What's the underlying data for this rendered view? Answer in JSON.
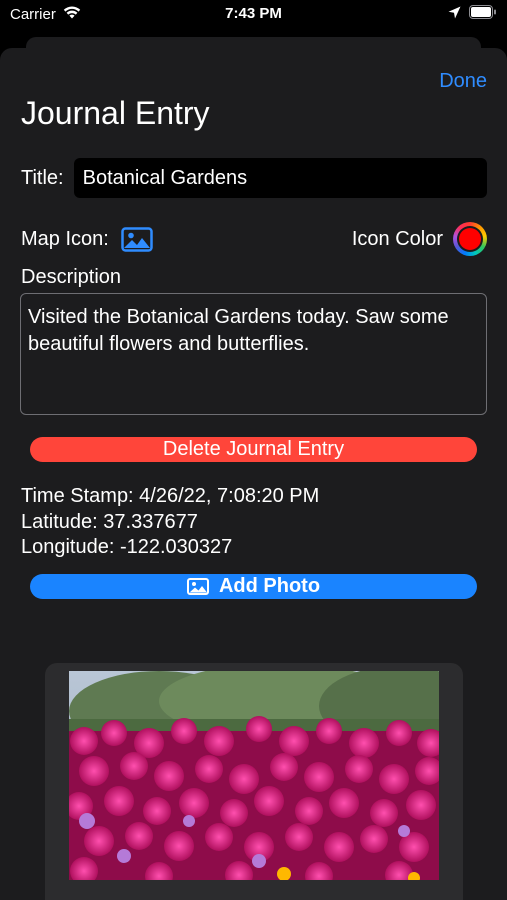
{
  "status_bar": {
    "carrier": "Carrier",
    "time": "7:43 PM"
  },
  "nav": {
    "done_label": "Done"
  },
  "page": {
    "title": "Journal Entry"
  },
  "form": {
    "title_label": "Title:",
    "title_value": "Botanical Gardens",
    "map_icon_label": "Map Icon:",
    "map_icon_name": "photo-icon",
    "icon_color_label": "Icon Color",
    "icon_color": "#ff0000",
    "description_label": "Description",
    "description_value": "Visited the Botanical Gardens today.  Saw some beautiful flowers and butterflies."
  },
  "actions": {
    "delete_label": "Delete Journal Entry",
    "add_photo_label": "Add Photo"
  },
  "info": {
    "timestamp": "Time Stamp: 4/26/22, 7:08:20 PM",
    "latitude": "Latitude: 37.337677",
    "longitude": "Longitude: -122.030327"
  },
  "colors": {
    "accent": "#2f8cff",
    "destructive": "#ff453a",
    "button_blue": "#1a84ff",
    "sheet_background": "#1c1c1e"
  }
}
